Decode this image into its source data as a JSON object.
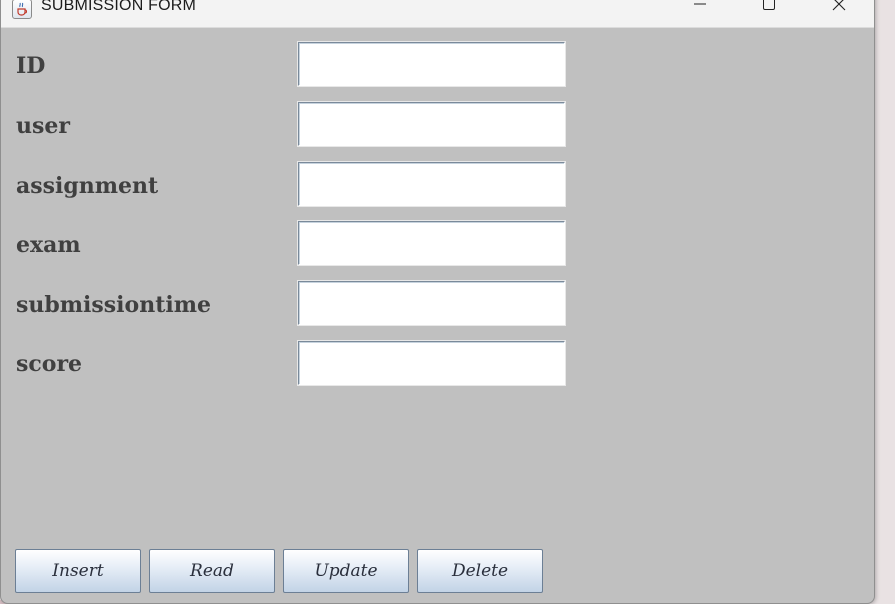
{
  "window": {
    "title": "SUBMISSION FORM",
    "app_icon": "java-cup-icon",
    "controls": {
      "minimize_icon": "minimize-icon",
      "maximize_icon": "maximize-icon",
      "close_icon": "close-icon"
    }
  },
  "form": {
    "fields": [
      {
        "label": "ID",
        "value": ""
      },
      {
        "label": "user",
        "value": ""
      },
      {
        "label": "assignment",
        "value": ""
      },
      {
        "label": "exam",
        "value": ""
      },
      {
        "label": "submissiontime",
        "value": ""
      },
      {
        "label": "score",
        "value": ""
      }
    ]
  },
  "actions": {
    "insert_label": "Insert",
    "read_label": "Read",
    "update_label": "Update",
    "delete_label": "Delete"
  },
  "colors": {
    "window_background": "#c0c0c0",
    "label_text": "#404040",
    "titlebar": "#f3f3f3",
    "button_gradient_bottom": "#c2d3e6"
  }
}
